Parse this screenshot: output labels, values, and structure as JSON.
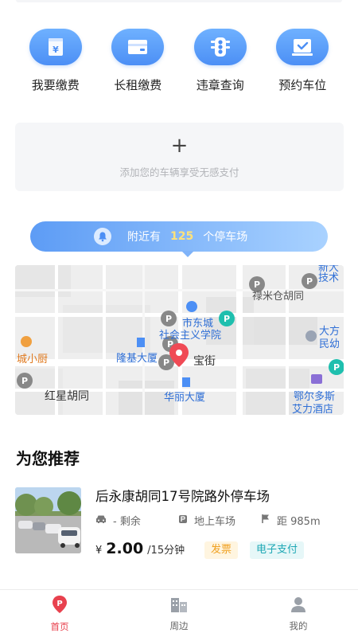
{
  "quick_actions": [
    {
      "label": "我要缴费",
      "icon": "yen-ticket-icon"
    },
    {
      "label": "长租缴费",
      "icon": "wallet-icon"
    },
    {
      "label": "违章查询",
      "icon": "traffic-light-icon"
    },
    {
      "label": "预约车位",
      "icon": "calendar-check-icon"
    }
  ],
  "add_car": {
    "plus": "+",
    "text": "添加您的车辆享受无感支付"
  },
  "nearby": {
    "prefix": "附近有",
    "count": "125",
    "suffix": "个停车场"
  },
  "map": {
    "labels": {
      "school": "市东城",
      "school2": "社会主义学院",
      "longji": "隆基大厦",
      "baojie": "宝街",
      "huali": "华丽大厦",
      "hongxing": "红星胡同",
      "xiaochu": "城小厨",
      "mi": "禄米仓胡同",
      "daf": "大方",
      "min": "民幼",
      "hotel": "鄂尔多斯",
      "hotel2": "艾力酒店",
      "tech": "技术",
      "xin": "新大"
    }
  },
  "recommend": {
    "title": "为您推荐",
    "items": [
      {
        "name": "后永康胡同17号院路外停车场",
        "remaining_label": "- 剩余",
        "type": "地上车场",
        "distance": "距 985m",
        "currency": "¥",
        "price": "2.00",
        "unit": "/15分钟",
        "tags": [
          "发票",
          "电子支付"
        ]
      }
    ]
  },
  "tabbar": {
    "items": [
      {
        "label": "首页",
        "active": true
      },
      {
        "label": "周边",
        "active": false
      },
      {
        "label": "我的",
        "active": false
      }
    ]
  },
  "colors": {
    "accent_blue": "#4c8ff5",
    "active_red": "#e8414e",
    "count_yellow": "#ffe27a",
    "tag_orange": "#f0a020",
    "tag_teal": "#1fa8b5"
  }
}
